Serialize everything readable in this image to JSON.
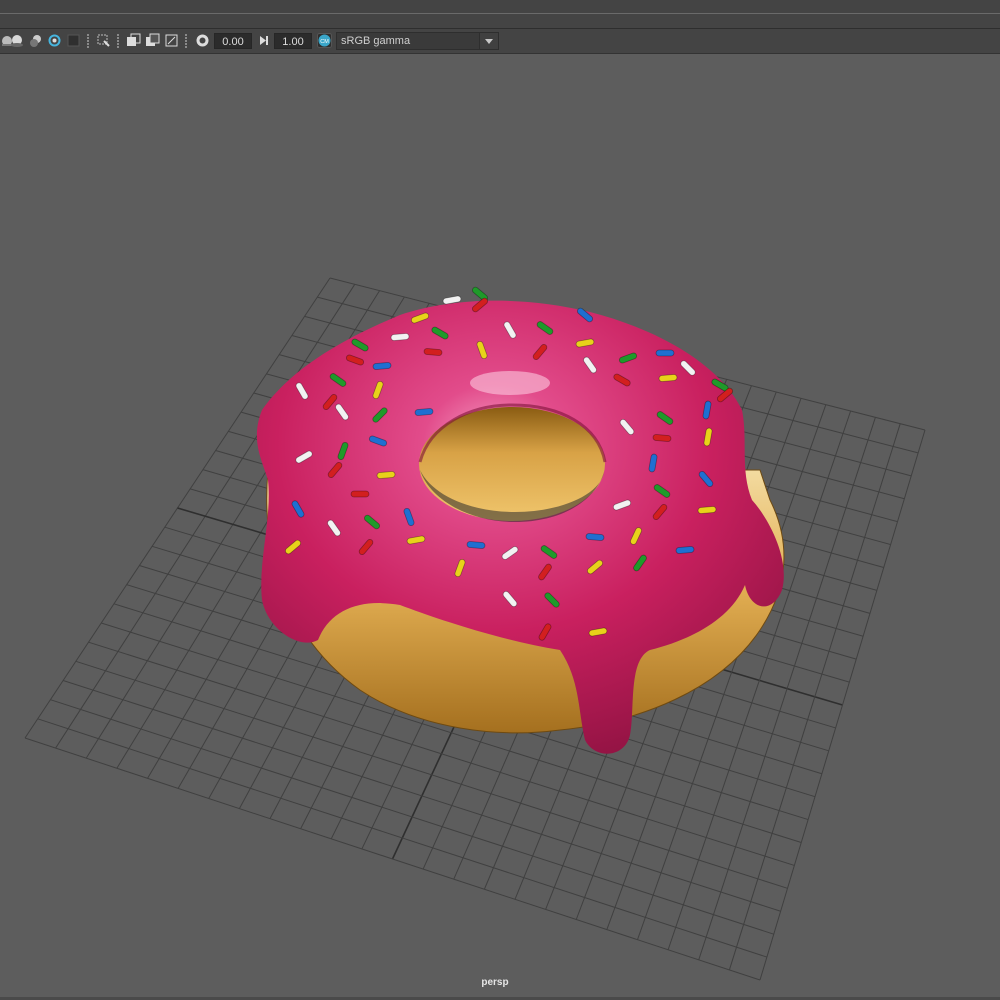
{
  "toolbar": {
    "exposure_value": "0.00",
    "gamma_value": "1.00",
    "colorspace": "sRGB gamma",
    "color_management_badge": "CM"
  },
  "viewport": {
    "camera_label": "persp"
  },
  "colors": {
    "background": "#5d5d5d",
    "grid": "#3f3f3f",
    "icing": "#d1276b",
    "dough": "#d9a344",
    "accent_badge": "#3aa6c9"
  },
  "sprinkle_colors": [
    "#d21f1f",
    "#1f9a2a",
    "#1f6fd1",
    "#e8d21a",
    "#f2f2f2"
  ]
}
